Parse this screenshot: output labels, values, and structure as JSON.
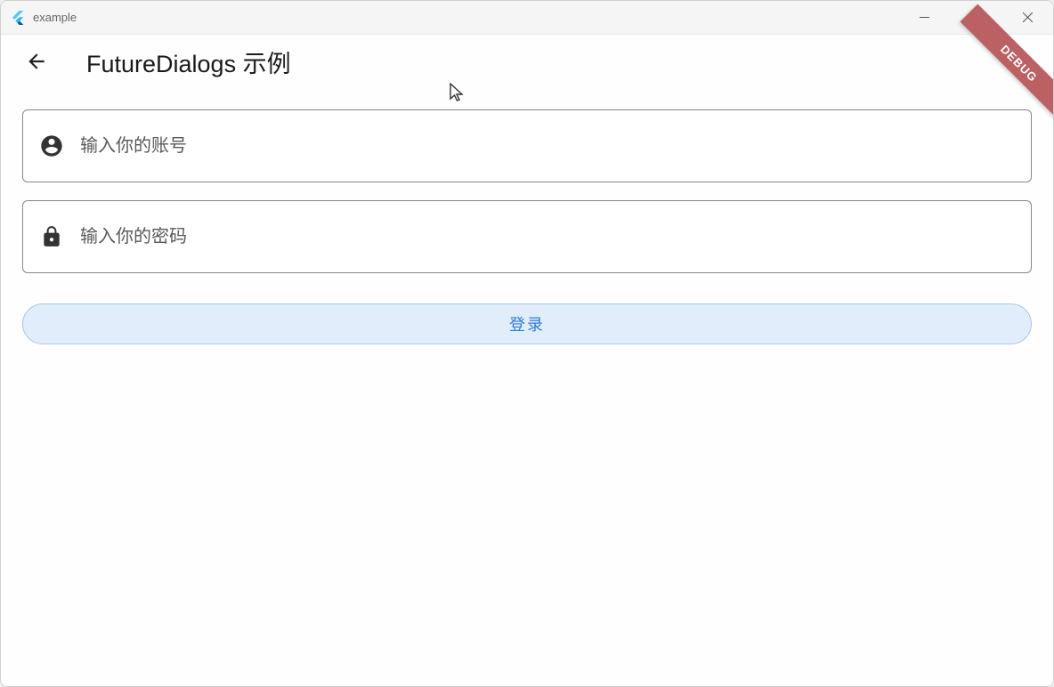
{
  "window": {
    "title": "example"
  },
  "appbar": {
    "title": "FutureDialogs 示例"
  },
  "form": {
    "username": {
      "placeholder": "输入你的账号",
      "value": ""
    },
    "password": {
      "placeholder": "输入你的密码",
      "value": ""
    },
    "loginLabel": "登录"
  },
  "debugRibbon": "DEBUG",
  "icons": {
    "back": "arrow-back",
    "person": "person-circle",
    "lock": "lock"
  },
  "colors": {
    "primary": "#2b7de0",
    "buttonBg": "#e2edfb",
    "buttonBorder": "#a9c8ef",
    "ribbon": "#bb6063"
  }
}
